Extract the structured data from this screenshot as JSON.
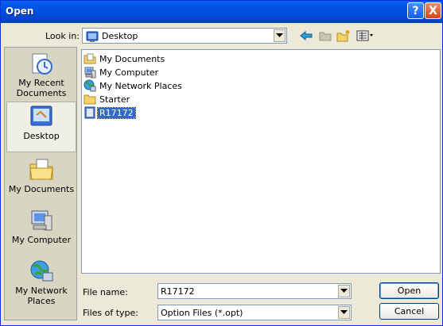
{
  "title": "Open",
  "title_buttons": {
    "help": "?",
    "close": "X"
  },
  "look_in": {
    "label": "Look in:",
    "value": "Desktop"
  },
  "places": [
    {
      "label": "My Recent Documents",
      "icon": "recent-documents-icon"
    },
    {
      "label": "Desktop",
      "icon": "desktop-icon",
      "selected": true
    },
    {
      "label": "My Documents",
      "icon": "my-documents-icon"
    },
    {
      "label": "My Computer",
      "icon": "my-computer-icon"
    },
    {
      "label": "My Network Places",
      "icon": "network-places-icon"
    }
  ],
  "files": [
    {
      "label": "My Documents",
      "icon": "folder-documents-icon"
    },
    {
      "label": "My Computer",
      "icon": "computer-icon"
    },
    {
      "label": "My Network Places",
      "icon": "network-icon"
    },
    {
      "label": "Starter",
      "icon": "folder-icon"
    },
    {
      "label": "R17172",
      "icon": "option-file-icon",
      "selected": true
    }
  ],
  "file_name": {
    "label": "File name:",
    "value": "R17172"
  },
  "file_type": {
    "label": "Files of type:",
    "value": "Option Files (*.opt)"
  },
  "buttons": {
    "open": "Open",
    "cancel": "Cancel"
  },
  "colors": {
    "titlebar": "#0054e3",
    "selection": "#316ac5",
    "dialog_bg": "#ece9d8"
  }
}
